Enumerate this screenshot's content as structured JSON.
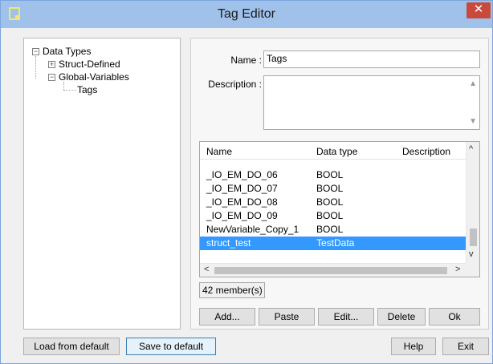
{
  "window": {
    "title": "Tag Editor",
    "close_glyph": "✕"
  },
  "tree": {
    "root": "Data Types",
    "children": [
      {
        "label": "Struct-Defined",
        "toggle": "+"
      },
      {
        "label": "Global-Variables",
        "toggle": "−",
        "children": [
          {
            "label": "Tags"
          }
        ]
      }
    ],
    "root_toggle": "−"
  },
  "form": {
    "name_label": "Name :",
    "name_value": "Tags",
    "description_label": "Description :",
    "description_value": ""
  },
  "table": {
    "columns": [
      "Name",
      "Data type",
      "Description"
    ],
    "rows": [
      {
        "name": "_IO_EM_DO_06",
        "type": "BOOL",
        "description": ""
      },
      {
        "name": "_IO_EM_DO_07",
        "type": "BOOL",
        "description": ""
      },
      {
        "name": "_IO_EM_DO_08",
        "type": "BOOL",
        "description": ""
      },
      {
        "name": "_IO_EM_DO_09",
        "type": "BOOL",
        "description": ""
      },
      {
        "name": "NewVariable_Copy_1",
        "type": "BOOL",
        "description": ""
      },
      {
        "name": "struct_test",
        "type": "TestData",
        "description": "",
        "selected": true
      }
    ],
    "member_count": "42 member(s)"
  },
  "buttons": {
    "add": "Add...",
    "paste": "Paste",
    "edit": "Edit...",
    "delete": "Delete",
    "ok": "Ok",
    "load_default": "Load from default",
    "save_default": "Save to default",
    "help": "Help",
    "exit": "Exit"
  },
  "colors": {
    "titlebar": "#9fc1ea",
    "selection": "#3399ff",
    "close": "#c74a3d"
  }
}
